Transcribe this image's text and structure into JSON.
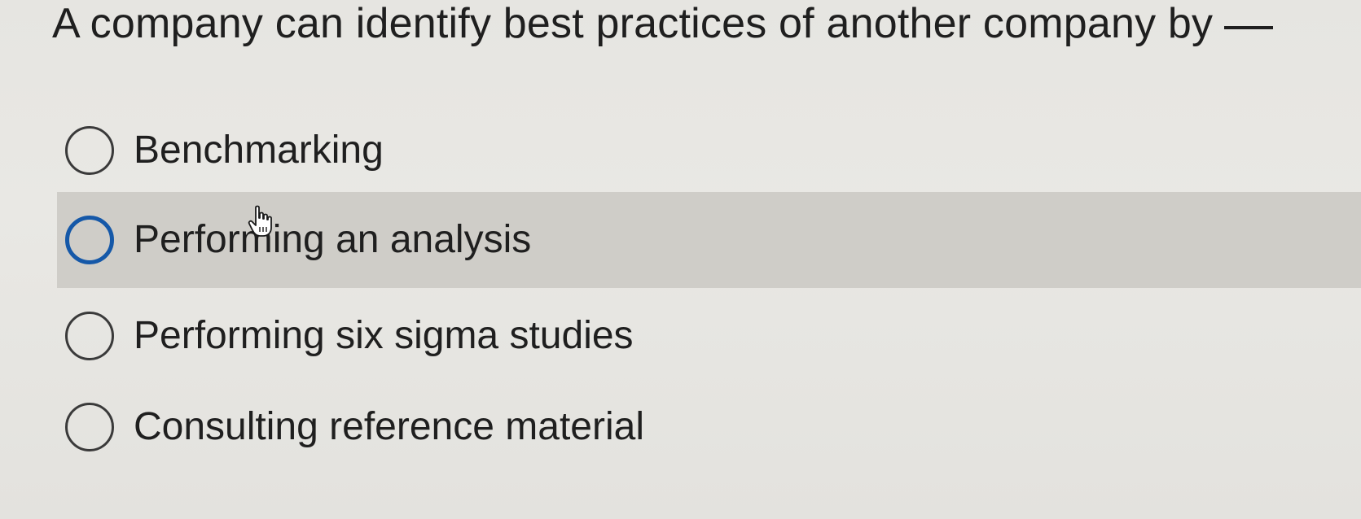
{
  "question": {
    "text": "A company can identify best practices of another company by"
  },
  "options": [
    {
      "label": "Benchmarking",
      "selected": false,
      "hovered": false
    },
    {
      "label": "Performing an analysis",
      "selected": false,
      "hovered": true
    },
    {
      "label": "Performing six sigma studies",
      "selected": false,
      "hovered": false
    },
    {
      "label": "Consulting reference material",
      "selected": false,
      "hovered": false
    }
  ],
  "colors": {
    "hover_row": "#cfcdc8",
    "focus_ring": "#1558a8",
    "background": "#e6e5e1"
  },
  "cursor_icon": "hand-pointer-icon"
}
